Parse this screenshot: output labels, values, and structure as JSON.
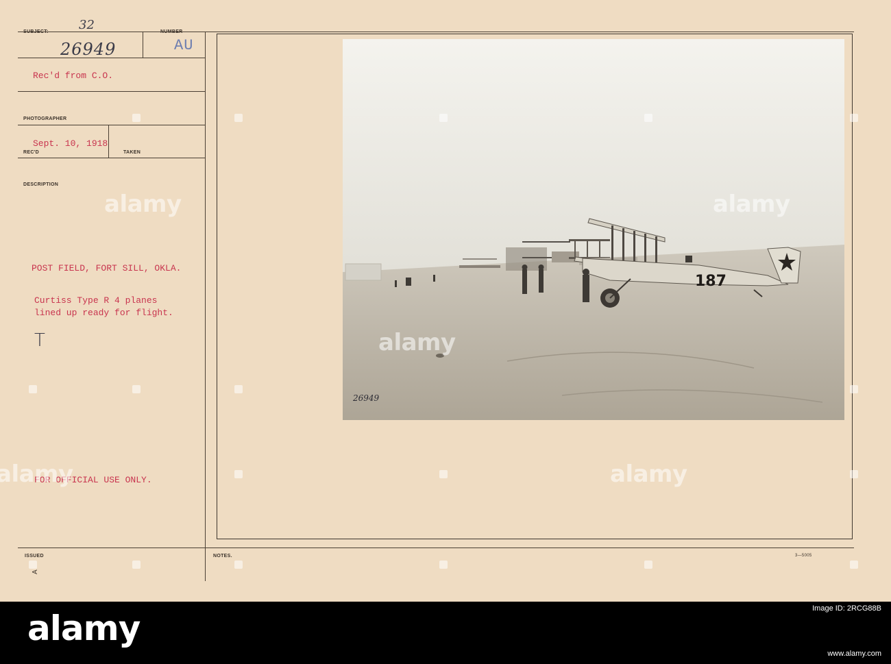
{
  "header": {
    "subject_label": "SUBJECT:",
    "subject_value": "32",
    "number_label": "NUMBER",
    "number_value": "26949",
    "number_code": "AU",
    "received_from": "Rec'd from C.O.",
    "photographer_label": "PHOTOGRAPHER",
    "date": "Sept. 10, 1918",
    "recd_label": "REC'D",
    "taken_label": "TAKEN",
    "description_label": "DESCRIPTION"
  },
  "description": {
    "location": "POST FIELD, FORT SILL, OKLA.",
    "line1": "Curtiss Type R 4 planes",
    "line2": "lined up ready for flight.",
    "mark": "T",
    "restriction": "FOR OFFICIAL USE ONLY."
  },
  "footer": {
    "issued_label": "ISSUED",
    "notes_label": "NOTES.",
    "issued_mark": "A",
    "form_code": "3—5005"
  },
  "photo": {
    "plane_number": "187",
    "negative_number": "26949"
  },
  "watermark": {
    "text": "alamy"
  },
  "banner": {
    "logo": "alamy",
    "image_id": "Image ID: 2RCG88B",
    "site": "www.alamy.com"
  }
}
